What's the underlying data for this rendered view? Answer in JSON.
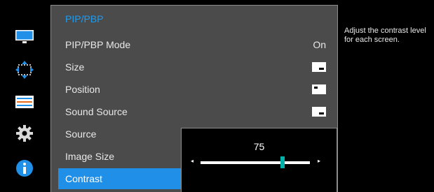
{
  "sidebar": {
    "icons": [
      "picture-icon",
      "onscreen-display-position-icon",
      "system-icon",
      "settings-gear-icon",
      "information-icon"
    ]
  },
  "menu": {
    "title": "PIP/PBP",
    "items": [
      {
        "label": "PIP/PBP Mode",
        "value": "On"
      },
      {
        "label": "Size",
        "icon": "pip-size-icon"
      },
      {
        "label": "Position",
        "icon": "pip-position-icon"
      },
      {
        "label": "Sound Source",
        "icon": "sound-source-icon"
      },
      {
        "label": "Source"
      },
      {
        "label": "Image Size"
      },
      {
        "label": "Contrast",
        "selected": true
      }
    ]
  },
  "popup": {
    "value": "75",
    "level": 75,
    "max": 100,
    "left_arrow": "◂",
    "right_arrow": "▸"
  },
  "help_text": "Adjust the contrast level for each screen.",
  "colors": {
    "accent": "#1f8fe8",
    "title": "#1c9cf0",
    "slider_thumb": "#00b2a9",
    "menu_bg": "#4b4b4b"
  }
}
